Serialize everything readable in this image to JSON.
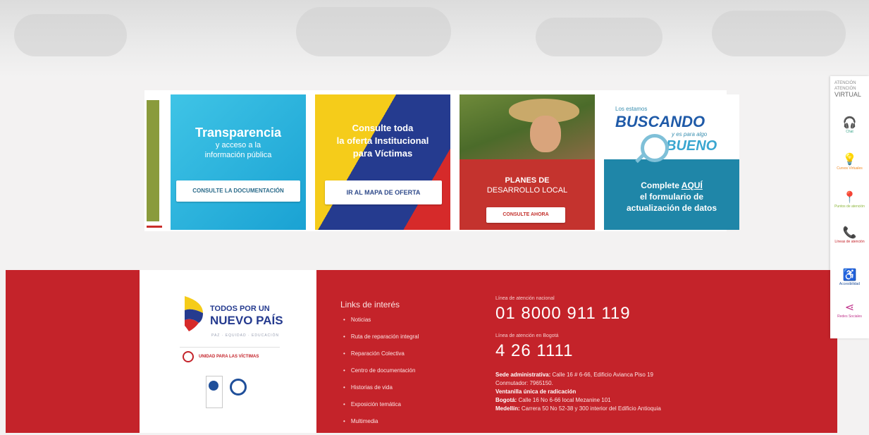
{
  "banners": {
    "transparencia": {
      "title": "Transparencia",
      "subtitle1": "y acceso a la",
      "subtitle2": "información pública",
      "button": "CONSULTE LA DOCUMENTACIÓN"
    },
    "oferta": {
      "line1": "Consulte toda",
      "line2": "la oferta Institucional",
      "line3": "para Víctimas",
      "button": "IR AL MAPA DE OFERTA"
    },
    "planes": {
      "line1": "PLANES DE",
      "line2": "DESARROLLO LOCAL",
      "button": "CONSULTE AHORA"
    },
    "buscando": {
      "top": "Los estamos",
      "big": "BUSCANDO",
      "small": "y es para algo",
      "bueno": "BUENO",
      "line1_pre": "Complete ",
      "line1_aqui": "AQUÍ",
      "line2": "el formulario de",
      "line3": "actualización de datos"
    }
  },
  "logos": {
    "brand_line1": "TODOS POR UN",
    "brand_line2": "NUEVO PAÍS",
    "brand_sub": "PAZ · EQUIDAD · EDUCACIÓN",
    "seal_text": "UNIDAD PARA LAS VÍCTIMAS"
  },
  "footer": {
    "links_title": "Links de interés",
    "links": [
      "Noticias",
      "Ruta de reparación integral",
      "Reparación Colectiva",
      "Centro de documentación",
      "Historias de vida",
      "Exposición temática",
      "Multimedia"
    ],
    "contact": {
      "national_label": "Línea de atención nacional",
      "national_number": "01 8000 911 119",
      "bogota_label": "Línea de atención en Bogotá",
      "bogota_number": "4 26 1111",
      "admin_label": "Sede administrativa:",
      "admin_value": "Calle 16 # 6-66, Edificio Avianca Piso 19",
      "conmutador": "Conmutador: 7965150.",
      "ventanilla_label": "Ventanilla única de radicación",
      "bogota_addr_label": "Bogotá:",
      "bogota_addr_value": "Calle 16 No 6-66 local Mezanine 101",
      "medellin_label": "Medellín:",
      "medellin_value": "Carrera 50 No 52-38 y 300 interior del Edificio Antioquia"
    }
  },
  "sidebar": {
    "title_small": "ATENCIÓN",
    "title_small2": "ATENCIÓN",
    "title_big": "VIRTUAL",
    "items": [
      {
        "label": "Chat",
        "icon": "headset-icon",
        "color": "#3aa58a",
        "glyph": "🎧"
      },
      {
        "label": "Cursos Virtuales",
        "icon": "lightbulb-icon",
        "color": "#f08a24",
        "glyph": "💡"
      },
      {
        "label": "Puntos de atención",
        "icon": "location-pin-icon",
        "color": "#8bb53a",
        "glyph": "📍"
      },
      {
        "label": "Líneas de atención",
        "icon": "phone-icon",
        "color": "#c4232a",
        "glyph": "📞"
      },
      {
        "label": "Accesibilidad",
        "icon": "accessibility-icon",
        "color": "#1f4f9a",
        "glyph": "♿"
      },
      {
        "label": "Redes Sociales",
        "icon": "share-icon",
        "color": "#c0348c",
        "glyph": "⋖"
      }
    ]
  }
}
